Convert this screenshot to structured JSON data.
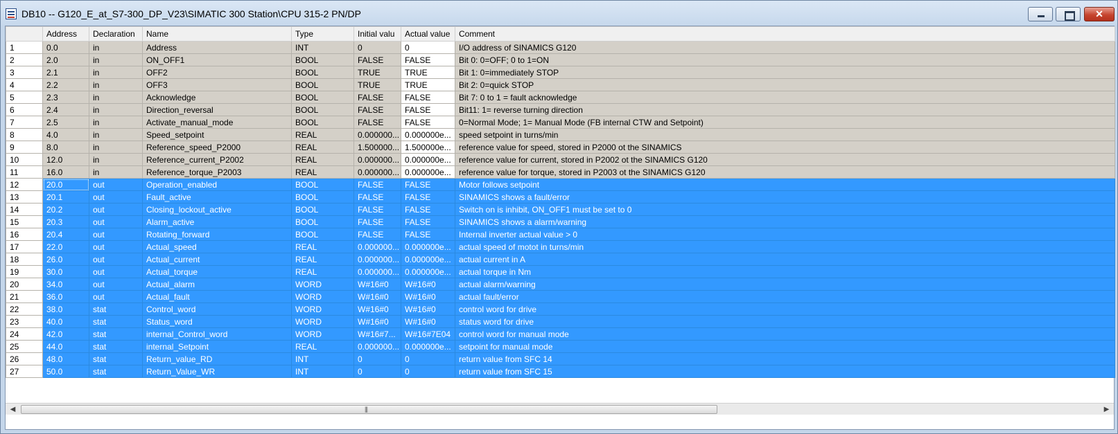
{
  "window": {
    "title": "DB10 -- G120_E_at_S7-300_DP_V23\\SIMATIC 300 Station\\CPU 315-2 PN/DP"
  },
  "colors": {
    "selection": "#3399ff",
    "cell_grey": "#d4d0c8",
    "title_bar": "#c6d8ec",
    "close_red": "#c6452f"
  },
  "icons": {
    "app": "db-editor-icon",
    "minimize": "minimize-icon",
    "maximize": "maximize-icon",
    "close": "close-icon",
    "scroll_left": "arrow-left-icon",
    "scroll_right": "arrow-right-icon",
    "grip": "grip-icon"
  },
  "table": {
    "columns": [
      "Address",
      "Declaration",
      "Name",
      "Type",
      "Initial valu",
      "Actual value",
      "Comment"
    ],
    "rows": [
      {
        "n": "1",
        "address": "0.0",
        "decl": "in",
        "name": "Address",
        "type": "INT",
        "initial": "0",
        "actual": "0",
        "comment": "I/O address of SINAMICS G120"
      },
      {
        "n": "2",
        "address": "2.0",
        "decl": "in",
        "name": "ON_OFF1",
        "type": "BOOL",
        "initial": "FALSE",
        "actual": "FALSE",
        "comment": "Bit 0: 0=OFF; 0 to 1=ON"
      },
      {
        "n": "3",
        "address": "2.1",
        "decl": "in",
        "name": "OFF2",
        "type": "BOOL",
        "initial": "TRUE",
        "actual": "TRUE",
        "comment": "Bit 1: 0=immediately STOP"
      },
      {
        "n": "4",
        "address": "2.2",
        "decl": "in",
        "name": "OFF3",
        "type": "BOOL",
        "initial": "TRUE",
        "actual": "TRUE",
        "comment": "Bit 2: 0=quick STOP"
      },
      {
        "n": "5",
        "address": "2.3",
        "decl": "in",
        "name": "Acknowledge",
        "type": "BOOL",
        "initial": "FALSE",
        "actual": "FALSE",
        "comment": "Bit 7: 0 to 1 = fault acknowledge"
      },
      {
        "n": "6",
        "address": "2.4",
        "decl": "in",
        "name": "Direction_reversal",
        "type": "BOOL",
        "initial": "FALSE",
        "actual": "FALSE",
        "comment": "Bit11: 1= reverse turning direction"
      },
      {
        "n": "7",
        "address": "2.5",
        "decl": "in",
        "name": "Activate_manual_mode",
        "type": "BOOL",
        "initial": "FALSE",
        "actual": "FALSE",
        "comment": "0=Normal Mode; 1= Manual Mode (FB internal CTW and Setpoint)"
      },
      {
        "n": "8",
        "address": "4.0",
        "decl": "in",
        "name": "Speed_setpoint",
        "type": "REAL",
        "initial": "0.000000...",
        "actual": "0.000000e...",
        "comment": "speed setpoint in turns/min"
      },
      {
        "n": "9",
        "address": "8.0",
        "decl": "in",
        "name": "Reference_speed_P2000",
        "type": "REAL",
        "initial": "1.500000...",
        "actual": "1.500000e...",
        "comment": "reference value for speed, stored in P2000 ot the SINAMICS"
      },
      {
        "n": "10",
        "address": "12.0",
        "decl": "in",
        "name": "Reference_current_P2002",
        "type": "REAL",
        "initial": "0.000000...",
        "actual": "0.000000e...",
        "comment": "reference value for current, stored in P2002 ot the SINAMICS G120"
      },
      {
        "n": "11",
        "address": "16.0",
        "decl": "in",
        "name": "Reference_torque_P2003",
        "type": "REAL",
        "initial": "0.000000...",
        "actual": "0.000000e...",
        "comment": "reference value for torque, stored in P2003 ot the SINAMICS G120"
      },
      {
        "n": "12",
        "address": "20.0",
        "decl": "out",
        "name": "Operation_enabled",
        "type": "BOOL",
        "initial": "FALSE",
        "actual": "FALSE",
        "comment": "Motor follows setpoint"
      },
      {
        "n": "13",
        "address": "20.1",
        "decl": "out",
        "name": "Fault_active",
        "type": "BOOL",
        "initial": "FALSE",
        "actual": "FALSE",
        "comment": "SINAMICS shows a fault/error"
      },
      {
        "n": "14",
        "address": "20.2",
        "decl": "out",
        "name": "Closing_lockout_active",
        "type": "BOOL",
        "initial": "FALSE",
        "actual": "FALSE",
        "comment": "Switch on is inhibit, ON_OFF1 must be set to 0"
      },
      {
        "n": "15",
        "address": "20.3",
        "decl": "out",
        "name": "Alarm_active",
        "type": "BOOL",
        "initial": "FALSE",
        "actual": "FALSE",
        "comment": "SINAMICS shows a alarm/warning"
      },
      {
        "n": "16",
        "address": "20.4",
        "decl": "out",
        "name": "Rotating_forward",
        "type": "BOOL",
        "initial": "FALSE",
        "actual": "FALSE",
        "comment": "Internal inverter actual value > 0"
      },
      {
        "n": "17",
        "address": "22.0",
        "decl": "out",
        "name": "Actual_speed",
        "type": "REAL",
        "initial": "0.000000...",
        "actual": "0.000000e...",
        "comment": "actual speed of motot in turns/min"
      },
      {
        "n": "18",
        "address": "26.0",
        "decl": "out",
        "name": "Actual_current",
        "type": "REAL",
        "initial": "0.000000...",
        "actual": "0.000000e...",
        "comment": "actual current in A"
      },
      {
        "n": "19",
        "address": "30.0",
        "decl": "out",
        "name": "Actual_torque",
        "type": "REAL",
        "initial": "0.000000...",
        "actual": "0.000000e...",
        "comment": "actual torque in Nm"
      },
      {
        "n": "20",
        "address": "34.0",
        "decl": "out",
        "name": "Actual_alarm",
        "type": "WORD",
        "initial": "W#16#0",
        "actual": "W#16#0",
        "comment": "actual alarm/warning"
      },
      {
        "n": "21",
        "address": "36.0",
        "decl": "out",
        "name": "Actual_fault",
        "type": "WORD",
        "initial": "W#16#0",
        "actual": "W#16#0",
        "comment": "actual fault/error"
      },
      {
        "n": "22",
        "address": "38.0",
        "decl": "stat",
        "name": "Control_word",
        "type": "WORD",
        "initial": "W#16#0",
        "actual": "W#16#0",
        "comment": "control word for drive"
      },
      {
        "n": "23",
        "address": "40.0",
        "decl": "stat",
        "name": "Status_word",
        "type": "WORD",
        "initial": "W#16#0",
        "actual": "W#16#0",
        "comment": "status word for drive"
      },
      {
        "n": "24",
        "address": "42.0",
        "decl": "stat",
        "name": "internal_Control_word",
        "type": "WORD",
        "initial": "W#16#7...",
        "actual": "W#16#7E04",
        "comment": "control word for manual mode"
      },
      {
        "n": "25",
        "address": "44.0",
        "decl": "stat",
        "name": "internal_Setpoint",
        "type": "REAL",
        "initial": "0.000000...",
        "actual": "0.000000e...",
        "comment": "setpoint for manual mode"
      },
      {
        "n": "26",
        "address": "48.0",
        "decl": "stat",
        "name": "Return_value_RD",
        "type": "INT",
        "initial": "0",
        "actual": "0",
        "comment": "return value from SFC 14"
      },
      {
        "n": "27",
        "address": "50.0",
        "decl": "stat",
        "name": "Return_Value_WR",
        "type": "INT",
        "initial": "0",
        "actual": "0",
        "comment": "return value from SFC 15"
      }
    ],
    "selected_from": 12
  }
}
